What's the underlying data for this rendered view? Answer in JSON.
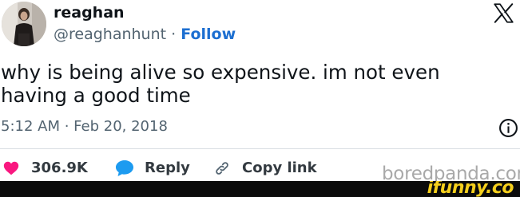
{
  "author": {
    "name": "reaghan",
    "handle": "@reaghanhunt",
    "separator": "·",
    "follow_label": "Follow"
  },
  "tweet": {
    "text": "why is being alive so expensive. im not even having a good time",
    "timestamp": "5:12 AM · Feb 20, 2018"
  },
  "actions": {
    "likes_count": "306.9K",
    "reply_label": "Reply",
    "copy_link_label": "Copy link"
  },
  "icons": {
    "brand": "x-logo-icon",
    "info": "info-icon",
    "like": "heart-icon",
    "reply": "speech-bubble-icon",
    "copy": "link-icon"
  },
  "watermarks": {
    "boredpanda": "boredpanda.com",
    "ifunny": "ifunny.co"
  },
  "colors": {
    "like": "#f91880",
    "reply": "#1d9bf0",
    "follow": "#1d6fd1",
    "ifunny": "#f5cf1c"
  }
}
